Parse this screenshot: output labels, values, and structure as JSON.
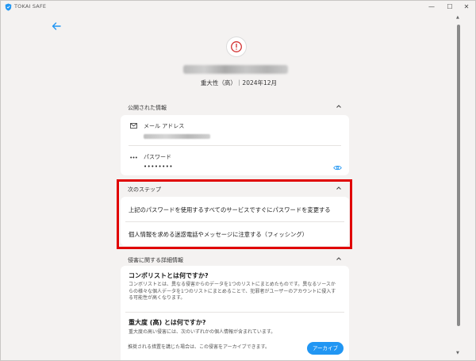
{
  "app": {
    "title": "TOKAI SAFE",
    "window_controls": {
      "minimize": "—",
      "maximize": "☐",
      "close": "✕"
    }
  },
  "breach": {
    "meta": "重大性（高）｜2024年12月"
  },
  "exposed_section": {
    "header": "公開された情報",
    "email_label": "メール アドレス",
    "password_label": "パスワード",
    "password_masked": "••••••••"
  },
  "next_steps": {
    "header": "次のステップ",
    "steps": [
      "上記のパスワードを使用するすべてのサービスですぐにパスワードを変更する",
      "個人情報を求める迷惑電話やメッセージに注意する（フィッシング）"
    ]
  },
  "details": {
    "header": "侵害に関する詳細情報",
    "faq": [
      {
        "title": "コンボリストとは何ですか?",
        "body": "コンボリストとは、異なる侵害からのデータを1つのリストにまとめたものです。異なるソースからの様々な個人データを1つのリストにまとめることで、犯罪者がユーザーのアカウントに侵入する可能性が高くなります。"
      },
      {
        "title": "重大度 (高) とは何ですか?",
        "body": "重大度の高い侵害には、次のいずれかの個人情報が含まれています。"
      }
    ],
    "archive_note": "推奨される措置を講じた場合は、この侵害をアーカイブできます。",
    "archive_button": "アーカイブ"
  },
  "colors": {
    "accent": "#2196f3",
    "alert": "#d32f2f",
    "highlight": "#e00000",
    "background": "#f4f2f1"
  },
  "icons": [
    "shield-logo-icon",
    "back-arrow-icon",
    "alert-icon",
    "chevron-up-icon",
    "envelope-icon",
    "password-dots-icon",
    "eye-icon"
  ]
}
